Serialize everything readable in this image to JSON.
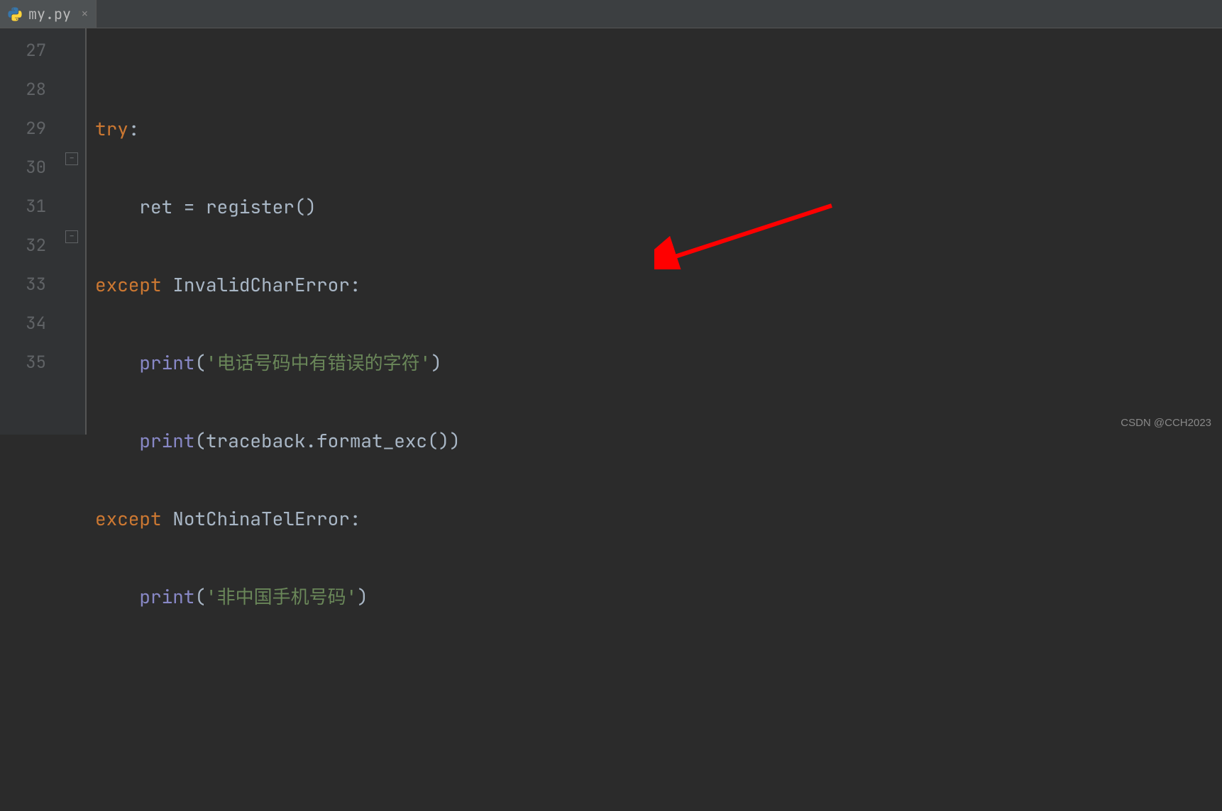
{
  "tab": {
    "filename": "my.py",
    "close_glyph": "×"
  },
  "gutter": {
    "lines": [
      "27",
      "28",
      "29",
      "30",
      "31",
      "32",
      "33",
      "34",
      "35"
    ]
  },
  "fold": {
    "minus": "−"
  },
  "code": {
    "l27": "",
    "l28": {
      "try": "try",
      "colon": ":"
    },
    "l29": {
      "indent": "    ",
      "ret": "ret = ",
      "register": "register",
      "parens": "()"
    },
    "l30": {
      "except": "except",
      "sp": " ",
      "err": "InvalidCharError",
      "colon": ":"
    },
    "l31": {
      "indent": "    ",
      "print": "print",
      "lp": "(",
      "str": "'电话号码中有错误的字符'",
      "rp": ")"
    },
    "l32": {
      "indent": "    ",
      "print": "print",
      "lp": "(",
      "tb": "traceback.format_exc()",
      "rp": ")"
    },
    "l33": {
      "except": "except",
      "sp": " ",
      "err": "NotChinaTelError",
      "colon": ":"
    },
    "l34": {
      "indent": "    ",
      "print": "print",
      "lp": "(",
      "str": "'非中国手机号码'",
      "rp": ")"
    },
    "l35": ""
  },
  "watermark": "CSDN @CCH2023"
}
